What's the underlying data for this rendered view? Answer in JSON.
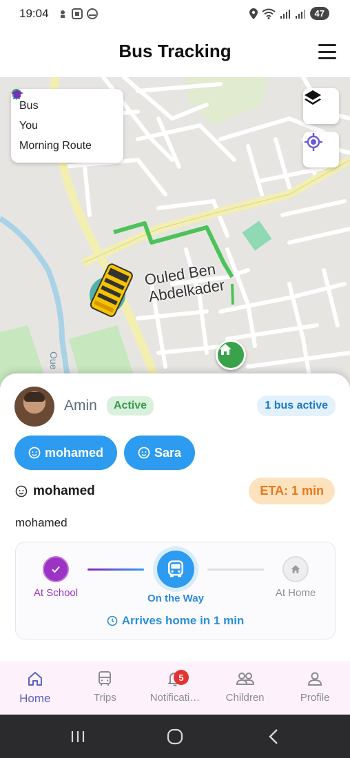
{
  "status_bar": {
    "time": "19:04",
    "battery": "47"
  },
  "header": {
    "title": "Bus Tracking"
  },
  "map": {
    "legend": [
      {
        "icon": "bus-icon",
        "label": "Bus",
        "color": "#2d9bf0"
      },
      {
        "icon": "location-pin-icon",
        "label": "You",
        "color": "#2ea44f"
      },
      {
        "icon": "graduation-cap-icon",
        "label": "Morning Route",
        "color": "#7b2cbf"
      }
    ],
    "place_name_line1": "Ouled Ben",
    "place_name_line2": "Abdelkader",
    "road_label": "Oue",
    "route_color": "#4cc35a"
  },
  "driver": {
    "name": "Amin",
    "status": "Active"
  },
  "bus_count": "1 bus active",
  "children": [
    "mohamed",
    "Sara"
  ],
  "selected_child": {
    "name": "mohamed",
    "subtitle": "mohamed",
    "eta": "ETA: 1 min"
  },
  "progress": {
    "steps": [
      "At School",
      "On the Way",
      "At Home"
    ],
    "current_step": 1,
    "arrives_text": "Arrives home in 1 min"
  },
  "nav": {
    "items": [
      {
        "label": "Home",
        "icon": "home-icon",
        "active": true
      },
      {
        "label": "Trips",
        "icon": "bus-icon"
      },
      {
        "label": "Notificati…",
        "icon": "bell-icon",
        "badge": "5"
      },
      {
        "label": "Children",
        "icon": "children-icon"
      },
      {
        "label": "Profile",
        "icon": "person-icon"
      }
    ]
  }
}
